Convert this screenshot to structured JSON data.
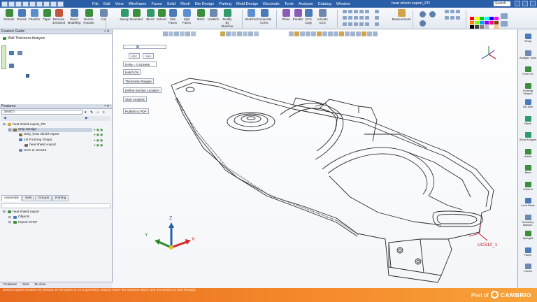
{
  "title_bar": {
    "menus": [
      "File",
      "Edit",
      "View",
      "Wireframe",
      "Faces",
      "Solid",
      "Mesh",
      "Die Design",
      "Parting",
      "Mold Design",
      "Electrode",
      "Tools",
      "Analysis",
      "Catalog",
      "Window"
    ],
    "document_title": "heat shield export_PD",
    "search_label": "Search"
  },
  "ribbon": {
    "buttons": [
      "Extrude",
      "Round",
      "Chamfer",
      "Taper",
      "Remove & Extend",
      "Direct Modelling",
      "Resize Rounds",
      "Cut",
      "Sweep",
      "Bounded",
      "Blend",
      "Extend",
      "Slim Faces",
      "Split Faces",
      "Stitch",
      "Unstitch",
      "Modify By Sketcher",
      "Sketcher",
      "Composite Curve",
      "Plane",
      "Parallel",
      "UCS Copy",
      "Activate UCS",
      "Measurement"
    ],
    "colors": [
      "#ff0000",
      "#ffff00",
      "#00cc00",
      "#00ffff",
      "#0000ff",
      "#ff00ff",
      "#ff8000",
      "#80ff00",
      "#00a0ff",
      "#8000ff",
      "#ff0080",
      "#804000",
      "#000000",
      "#404040",
      "#808080",
      "#c0c0c0",
      "#ffffff",
      "#ffc080"
    ]
  },
  "feature_guide": {
    "title": "Feature Guide",
    "item": "Wall Thickness Analysis"
  },
  "features": {
    "title": "Features",
    "search_placeholder": "Search",
    "tree": [
      {
        "label": "heat shield export_PD",
        "level": 0
      },
      {
        "label": "Strip Design",
        "level": 1
      },
      {
        "label": "Strip_heat shield export",
        "level": 2
      },
      {
        "label": "1st Forming Shape",
        "level": 2
      },
      {
        "label": "heat shield export",
        "level": 3
      },
      {
        "label": "UCS to UCS15",
        "level": 2
      }
    ],
    "tabs": [
      "Assembly",
      "Sets",
      "Groups",
      "Parting"
    ]
  },
  "objects_panel": {
    "tree": [
      {
        "label": "heat shield export",
        "level": 0
      },
      {
        "label": "Objects",
        "level": 1
      },
      {
        "label": "Import STEP",
        "level": 1
      }
    ]
  },
  "bottom_tabs": [
    "Features",
    "Sets",
    "M-View"
  ],
  "wall_thickness": {
    "prev_label": "<<<",
    "next_label": ">>>",
    "delta": "Delta = 0.019885",
    "hatch": "Hatch On",
    "ranges": "Thickness Ranges",
    "section": "Define Section Location",
    "start": "Start Analysis",
    "publish": "Publish to PDF"
  },
  "viewport": {
    "ucs_label": "UCS10_1",
    "axes": {
      "x": "X",
      "y": "Y",
      "z": "Z"
    }
  },
  "right_panel": {
    "tools": [
      "Setup",
      "Analysis Tools",
      "Form CS",
      "Forming Shapes",
      "Die Size",
      "Blank",
      "Show Analysis",
      "Unfold",
      "Bend",
      "Unbend",
      "Local Blank",
      "Geometry Manipul.",
      "Springbk",
      "Faces",
      "Curves"
    ]
  },
  "status": {
    "text": "Define a plane location by clicking on the plane or on a geometry; drag to move the analysis plane; use the arrows to step through.",
    "brand_prefix": "Part of",
    "brand_name": "CAMBRIO"
  }
}
